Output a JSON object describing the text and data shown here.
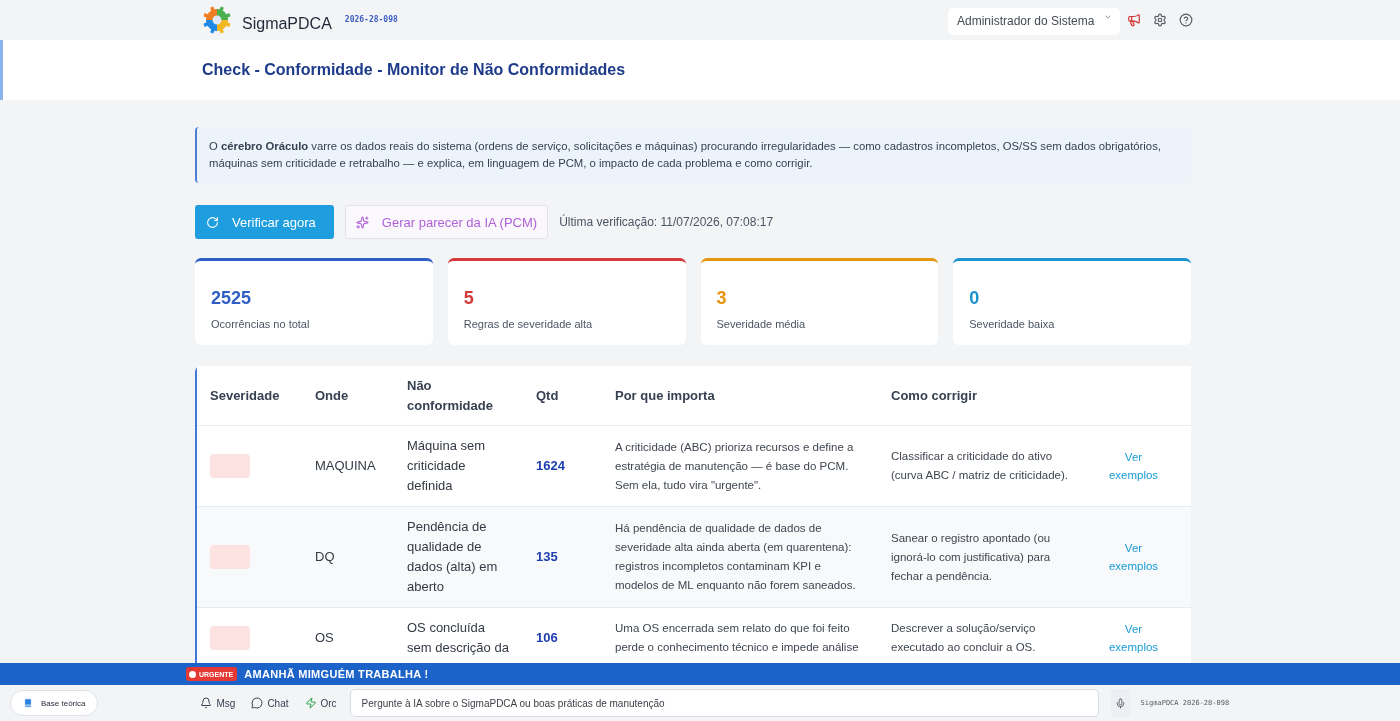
{
  "header": {
    "app_name": "SigmaPDCA",
    "version": "2026-28-098",
    "user": "Administrador do Sistema"
  },
  "page_title": "Check - Conformidade - Monitor de Não Conformidades",
  "info": "O **cérebro Oráculo** varre os dados reais do sistema (ordens de serviço, solicitações e máquinas) procurando irregularidades — como cadastros incompletos, OS/SS sem dados obrigatórios, máquinas sem criticidade e retrabalho — e explica, em linguagem de PCM, o impacto de cada problema e como corrigir.",
  "actions": [
    {
      "kind": "primary",
      "label": "Verificar agora"
    },
    {
      "kind": "ai",
      "label": "Gerar parecer da IA (PCM)"
    }
  ],
  "last_check": "Última verificação: 11/07/2026, 07:08:17",
  "stats": [
    {
      "value": "2525",
      "label": "Ocorrências no total",
      "color": "#2f5fc4"
    },
    {
      "value": "5",
      "label": "Regras de severidade alta",
      "color": "#d43a3a"
    },
    {
      "value": "3",
      "label": "Severidade média",
      "color": "#e5960f"
    },
    {
      "value": "0",
      "label": "Severidade baixa",
      "color": "#1b93cf"
    }
  ],
  "table": {
    "columns": [
      "Severidade",
      "Onde",
      "Não conformidade",
      "Qtd",
      "Por que importa",
      "Como corrigir"
    ],
    "rows": [
      {
        "color": "#fde2e2",
        "where": "MAQUINA",
        "issue": "Máquina sem criticidade definida",
        "qty": "1624",
        "why": "A criticidade (ABC) prioriza recursos e define a estratégia de manutenção — é base do PCM. Sem ela, tudo vira \"urgente\".",
        "fix": "Classificar a criticidade do ativo (curva ABC / matriz de criticidade).",
        "link": "Ver exemplos"
      },
      {
        "color": "#fde2e2",
        "where": "DQ",
        "issue": "Pendência de qualidade de dados (alta) em aberto",
        "qty": "135",
        "why": "Há pendência de qualidade de dados de severidade alta ainda aberta (em quarentena): registros incompletos contaminam KPI e modelos de ML enquanto não forem saneados.",
        "fix": "Sanear o registro apontado (ou ignorá-lo com justificativa) para fechar a pendência.",
        "link": "Ver exemplos"
      },
      {
        "color": "#fde2e2",
        "where": "OS",
        "issue": "OS concluída sem descrição da",
        "qty": "106",
        "why": "Uma OS encerrada sem relato do que foi feito perde o conhecimento técnico e impede análise",
        "fix": "Descrever a solução/serviço executado ao concluir a OS.",
        "link": "Ver exemplos"
      }
    ]
  },
  "alert": {
    "badge": "URGENTE",
    "message": "AMANHÃ MIMGUÉM TRABALHA !"
  },
  "bottom_bar": {
    "kb_button": "Base teórica",
    "shortcuts": [
      {
        "kind": "msg",
        "label": "Msg"
      },
      {
        "kind": "chat",
        "label": "Chat"
      },
      {
        "kind": "orc",
        "label": "Orc"
      }
    ],
    "ask": {
      "placeholder": "Pergunte à IA sobre o SigmaPDCA ou boas práticas de manutenção"
    },
    "version": "SigmaPDCA 2026-28-098"
  }
}
